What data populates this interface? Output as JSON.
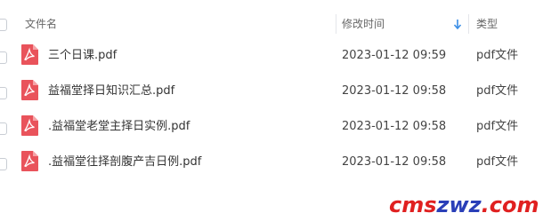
{
  "header": {
    "name_label": "文件名",
    "modified_label": "修改时间",
    "type_label": "类型"
  },
  "files": [
    {
      "name": "三个日课.pdf",
      "modified": "2023-01-12 09:59",
      "type": "pdf文件",
      "icon": "pdf-file-icon"
    },
    {
      "name": "益福堂择日知识汇总.pdf",
      "modified": "2023-01-12 09:58",
      "type": "pdf文件",
      "icon": "pdf-file-icon"
    },
    {
      "name": ".益福堂老堂主择日实例.pdf",
      "modified": "2023-01-12 09:58",
      "type": "pdf文件",
      "icon": "pdf-file-icon"
    },
    {
      "name": ".益福堂往择剖腹产吉日例.pdf",
      "modified": "2023-01-12 09:58",
      "type": "pdf文件",
      "icon": "pdf-file-icon"
    }
  ],
  "watermark": "www.cmszwz.com",
  "colors": {
    "pdf_icon": "#e9535b",
    "sort_arrow": "#3a8ee6",
    "watermark_red": "#e02020",
    "watermark_blue": "#2a3fb8"
  }
}
